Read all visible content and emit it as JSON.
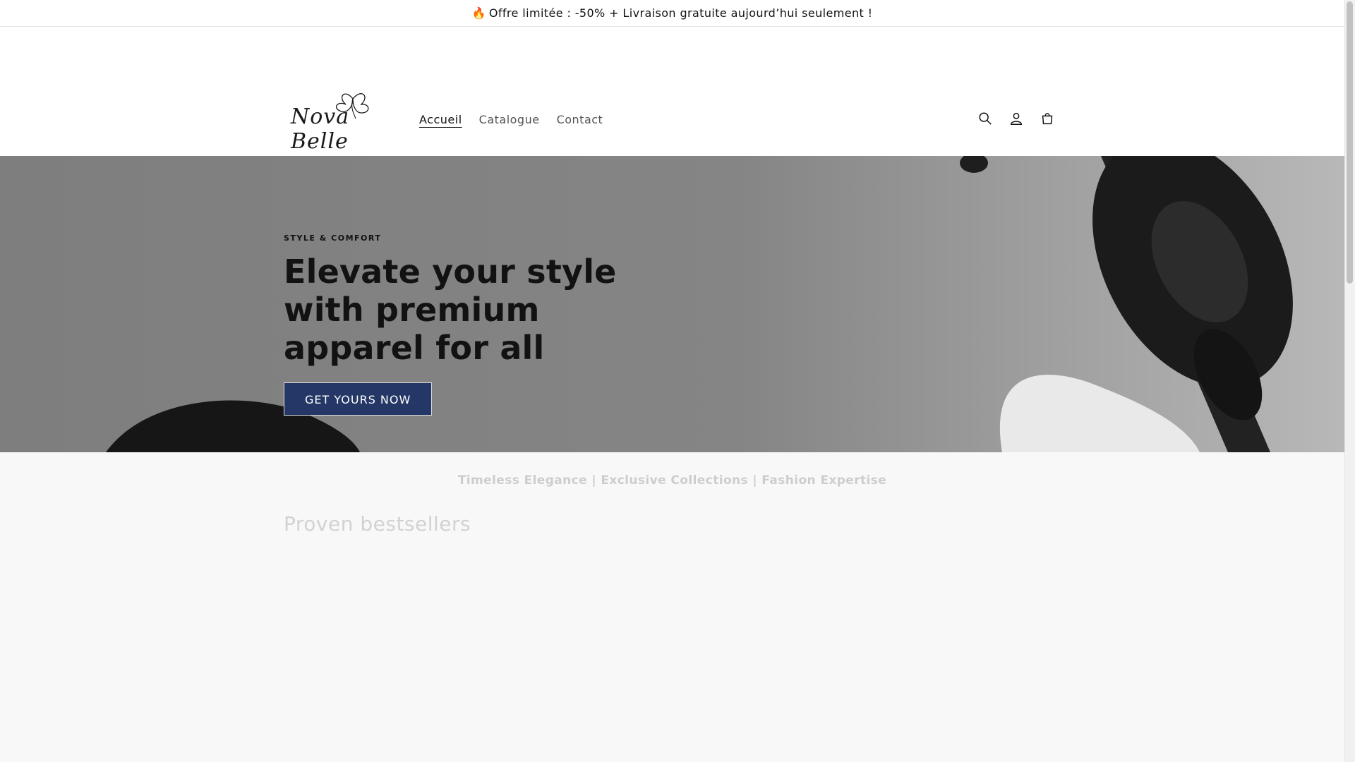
{
  "announcement": {
    "icon": "flame-icon",
    "text": "Offre limitée : -50% + Livraison gratuite aujourd’hui seulement !"
  },
  "header": {
    "logo_text": "Nova Belle",
    "nav": [
      {
        "label": "Accueil",
        "active": true
      },
      {
        "label": "Catalogue",
        "active": false
      },
      {
        "label": "Contact",
        "active": false
      }
    ],
    "icons": [
      "search-icon",
      "account-icon",
      "cart-icon"
    ]
  },
  "hero": {
    "eyebrow": "STYLE & COMFORT",
    "title": "Elevate your style with premium apparel for all",
    "cta": "GET YOURS NOW",
    "cta_color": "#243766"
  },
  "marquee": {
    "text": "Timeless Elegance | Exclusive Collections | Fashion Expertise"
  },
  "bestsellers": {
    "title": "Proven bestsellers"
  }
}
